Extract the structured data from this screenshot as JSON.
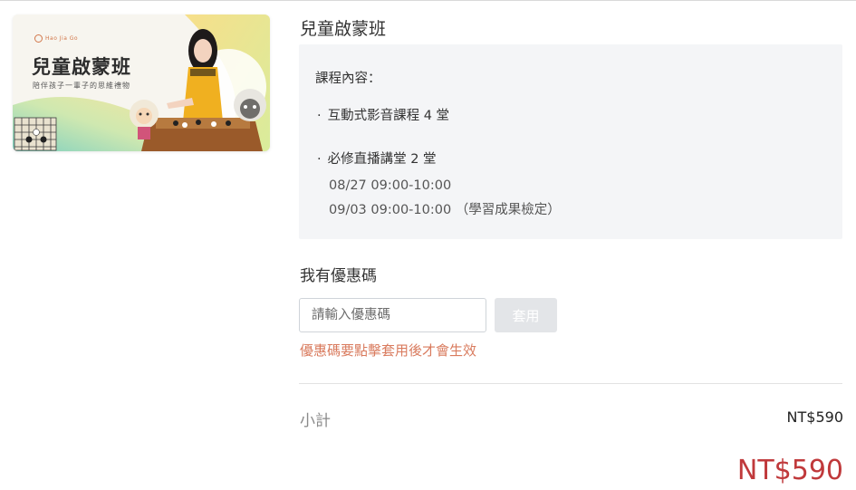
{
  "banner": {
    "brand": "Hao Jia Go",
    "title": "兒童啟蒙班",
    "subtitle": "陪伴孩子一輩子的思維禮物"
  },
  "course": {
    "title": "兒童啟蒙班"
  },
  "content": {
    "heading": "課程內容：",
    "items": [
      {
        "bullet": "·",
        "label": "互動式影音課程 4 堂"
      },
      {
        "bullet": "·",
        "label": "必修直播講堂 2 堂"
      }
    ],
    "sessions": [
      "08/27 09:00-10:00",
      "09/03 09:00-10:00 （學習成果檢定）"
    ]
  },
  "coupon": {
    "heading": "我有優惠碼",
    "placeholder": "請輸入優惠碼",
    "value": "",
    "apply_label": "套用",
    "note": "優惠碼要點擊套用後才會生效"
  },
  "summary": {
    "subtotal_label": "小計",
    "subtotal_value": "NT$590",
    "total_value": "NT$590"
  },
  "colors": {
    "accent_red": "#c0393b",
    "note_orange": "#d97b5e",
    "box_bg": "#f4f5f7",
    "button_disabled": "#e3e5e8"
  }
}
